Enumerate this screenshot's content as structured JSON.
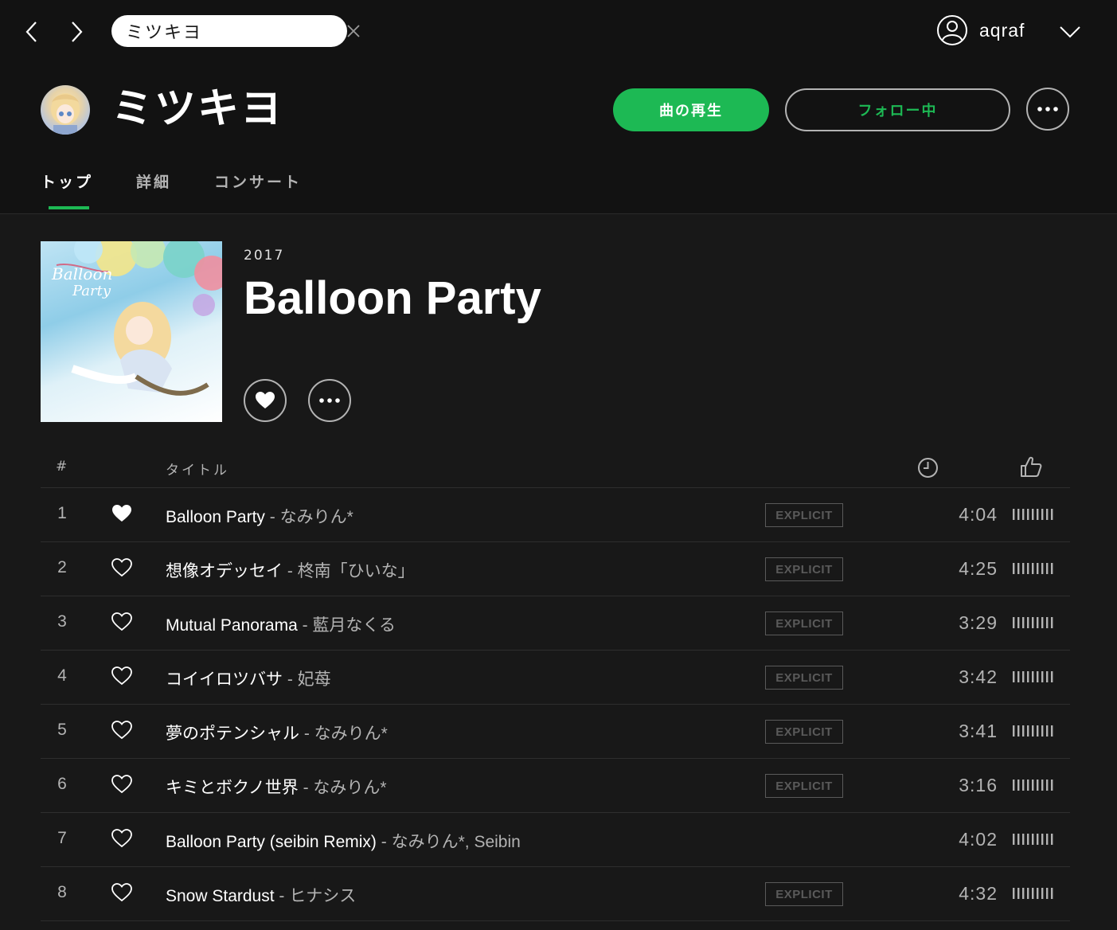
{
  "nav": {
    "back_icon": "chevron-left-icon",
    "forward_icon": "chevron-right-icon"
  },
  "search": {
    "value": "ミツキヨ",
    "placeholder": "",
    "icon": "search-icon",
    "clear_icon": "close-icon"
  },
  "user": {
    "name": "aqraf",
    "icon": "user-icon",
    "menu_icon": "chevron-down-icon"
  },
  "artist": {
    "name": "ミツキヨ",
    "play_label": "曲の再生",
    "follow_label": "フォロー中",
    "more_icon": "more-icon"
  },
  "tabs": [
    {
      "label": "トップ",
      "active": true
    },
    {
      "label": "詳細",
      "active": false
    },
    {
      "label": "コンサート",
      "active": false
    }
  ],
  "album": {
    "year": "2017",
    "title": "Balloon Party",
    "like_icon": "heart-icon",
    "more_icon": "more-icon"
  },
  "table": {
    "col_number": "#",
    "col_title": "タイトル",
    "col_duration_icon": "clock-icon",
    "col_popularity_icon": "thumbs-up-icon"
  },
  "tracks": [
    {
      "number": "1",
      "title": "Balloon Party",
      "separator": " - ",
      "artists": "なみりん*",
      "explicit": "EXPLICIT",
      "duration": "4:04",
      "liked": true,
      "popularity": 1.0
    },
    {
      "number": "2",
      "title": "想像オデッセイ",
      "separator": " - ",
      "artists": "柊南「ひいな」",
      "explicit": "EXPLICIT",
      "duration": "4:25",
      "liked": false,
      "popularity": 1.0
    },
    {
      "number": "3",
      "title": "Mutual Panorama",
      "separator": " - ",
      "artists": "藍月なくる",
      "explicit": "EXPLICIT",
      "duration": "3:29",
      "liked": false,
      "popularity": 1.0
    },
    {
      "number": "4",
      "title": "コイイロツバサ",
      "separator": " - ",
      "artists": "妃苺",
      "explicit": "EXPLICIT",
      "duration": "3:42",
      "liked": false,
      "popularity": 1.0
    },
    {
      "number": "5",
      "title": "夢のポテンシャル",
      "separator": " - ",
      "artists": "なみりん*",
      "explicit": "EXPLICIT",
      "duration": "3:41",
      "liked": false,
      "popularity": 1.0
    },
    {
      "number": "6",
      "title": "キミとボクノ世界",
      "separator": " - ",
      "artists": "なみりん*",
      "explicit": "EXPLICIT",
      "duration": "3:16",
      "liked": false,
      "popularity": 1.0
    },
    {
      "number": "7",
      "title": "Balloon Party (seibin Remix)",
      "separator": " - ",
      "artists": "なみりん*, Seibin",
      "explicit": "",
      "duration": "4:02",
      "liked": false,
      "popularity": 1.0
    },
    {
      "number": "8",
      "title": "Snow Stardust",
      "separator": " - ",
      "artists": "ヒナシス",
      "explicit": "EXPLICIT",
      "duration": "4:32",
      "liked": false,
      "popularity": 1.0
    }
  ],
  "colors": {
    "accent": "#1db954",
    "background": "#181818",
    "topbar": "#121212",
    "muted": "#b3b3b3"
  }
}
